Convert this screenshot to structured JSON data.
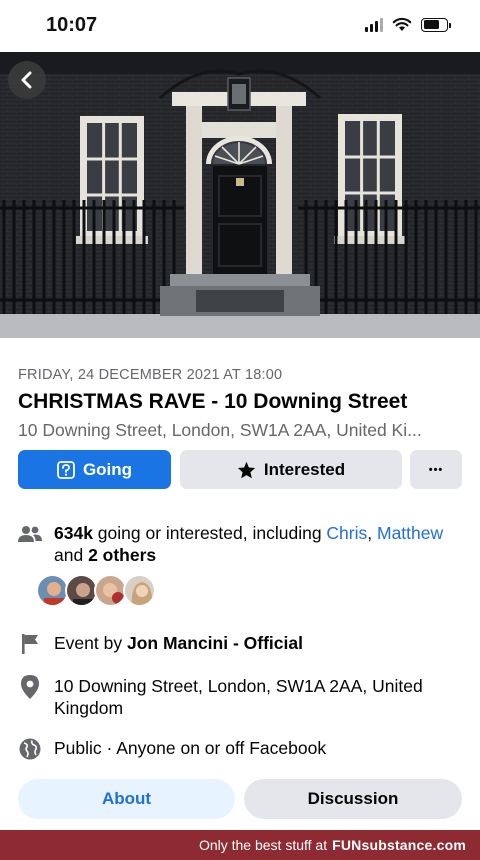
{
  "status_bar": {
    "time": "10:07"
  },
  "event": {
    "date": "FRIDAY, 24 DECEMBER 2021 AT 18:00",
    "title": "CHRISTMAS RAVE - 10 Downing Street",
    "location_short": "10 Downing Street, London, SW1A 2AA, United Ki..."
  },
  "actions": {
    "going_label": "Going",
    "interested_label": "Interested",
    "more_label": "•••"
  },
  "details": {
    "attendance_count": "634k",
    "attendance_text": " going or interested, including ",
    "friend_1": "Chris",
    "separator": ", ",
    "friend_2": "Matthew",
    "and_text": "and ",
    "others": "2 others",
    "host_prefix": "Event by ",
    "host_name": "Jon Mancini - Official",
    "address": "10 Downing Street, London, SW1A 2AA, United Kingdom",
    "privacy": "Public · Anyone on or off Facebook"
  },
  "tabs": {
    "about": "About",
    "discussion": "Discussion"
  },
  "footer": {
    "tagline": "Only the best stuff at",
    "brand_bold": "FUN",
    "brand_rest": "substance.com"
  },
  "colors": {
    "accent": "#1b74e4",
    "link": "#216fdb",
    "secondary_text": "#65676b",
    "button_grey": "#e4e6eb",
    "footer_bg": "#8e2b32"
  }
}
